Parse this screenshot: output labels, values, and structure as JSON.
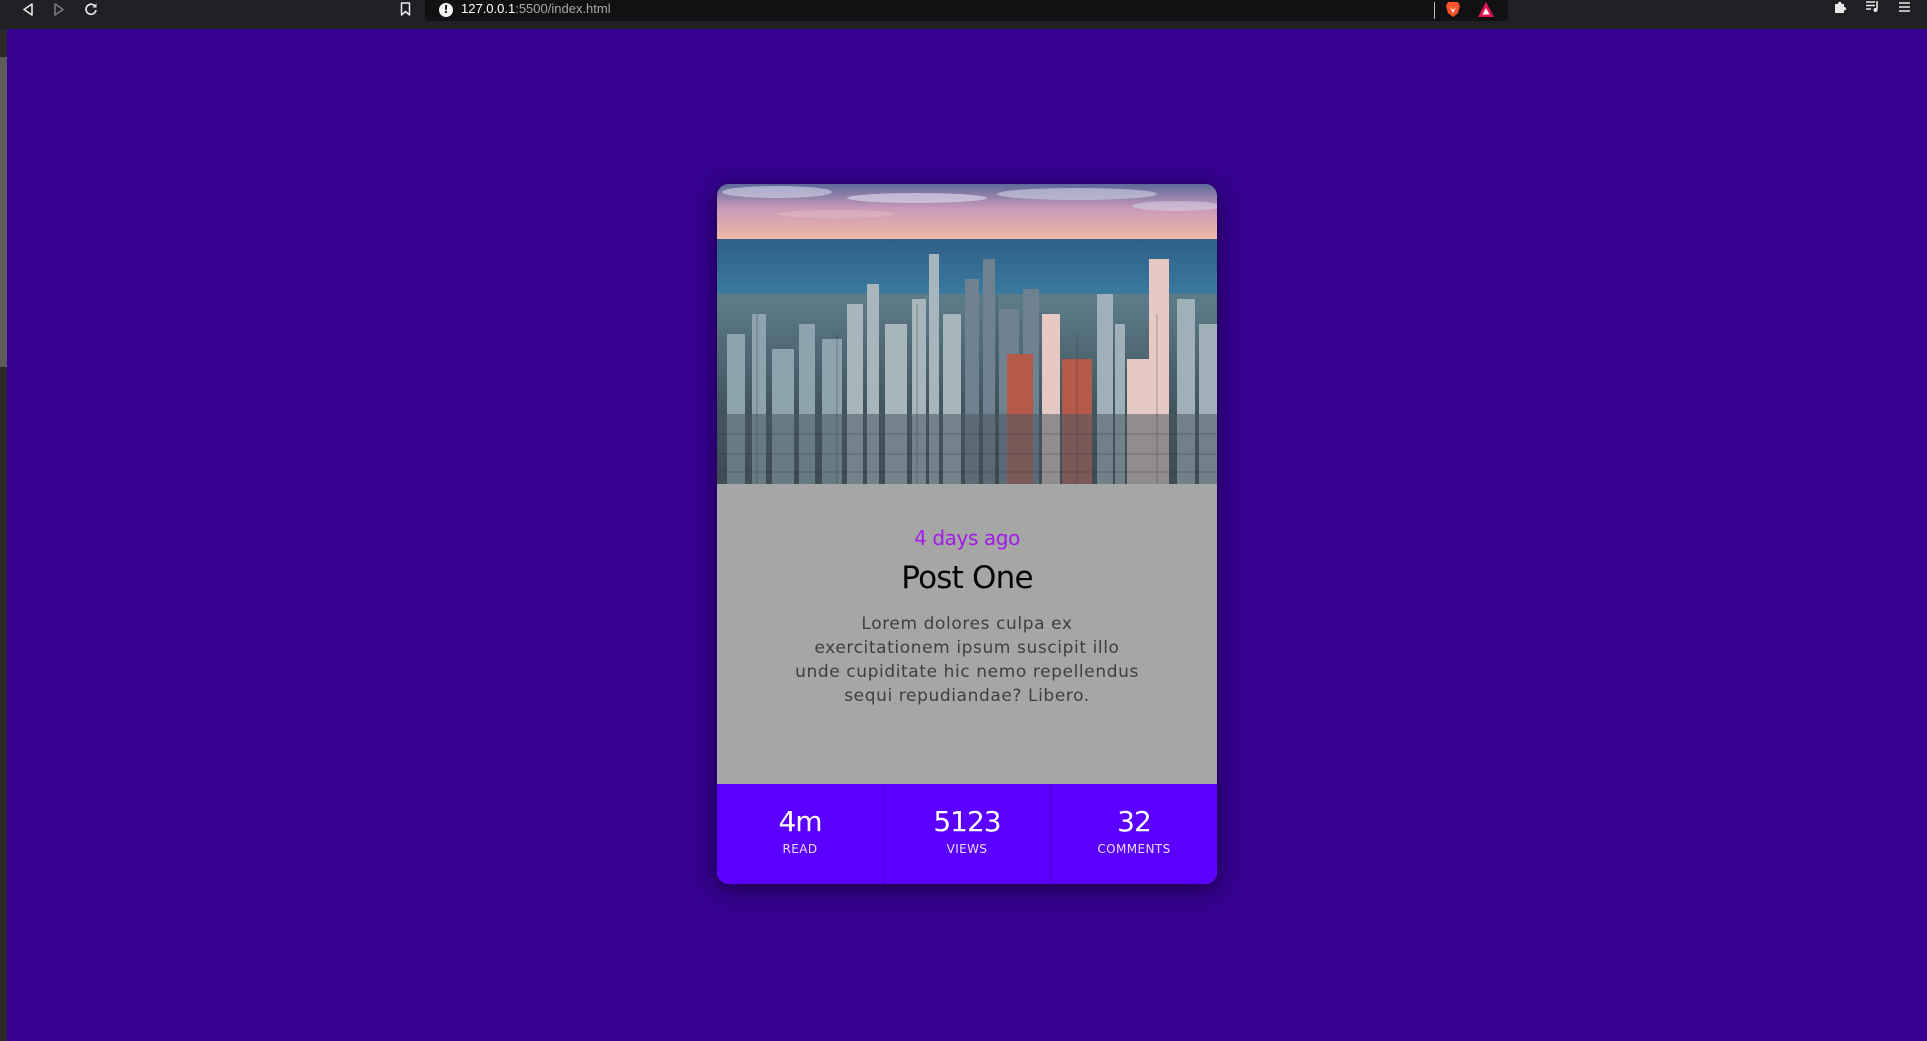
{
  "browser": {
    "url_host": "127.0.0.1",
    "url_path": ":5500/index.html",
    "icons": {
      "back": "back-arrow-icon",
      "forward": "forward-arrow-icon",
      "reload": "reload-icon",
      "bookmark": "bookmark-icon",
      "site_info": "info-icon",
      "brave_shields": "brave-lion-icon",
      "rewards": "rewards-triangle-icon",
      "extensions": "puzzle-icon",
      "playlist": "playlist-icon",
      "menu": "hamburger-menu-icon"
    }
  },
  "colors": {
    "page_background": "#35008f",
    "card_text_background": "#a6a6a6",
    "stats_background": "#5b00ff",
    "date_color": "#a21ae8"
  },
  "card": {
    "image": "city-skyline-photo",
    "date": "4 days ago",
    "title": "Post One",
    "body": "Lorem dolores culpa ex exercitationem ipsum suscipit illo unde cupiditate hic nemo repellendus sequi repudiandae? Libero.",
    "stats": [
      {
        "value": "4m",
        "label": "READ"
      },
      {
        "value": "5123",
        "label": "VIEWS"
      },
      {
        "value": "32",
        "label": "COMMENTS"
      }
    ]
  }
}
